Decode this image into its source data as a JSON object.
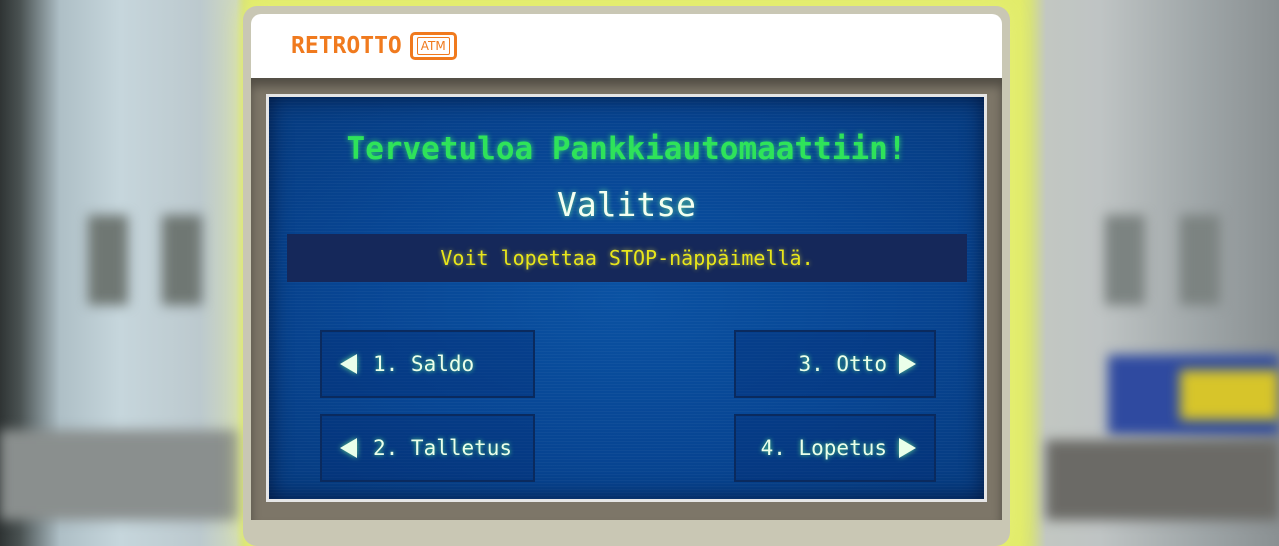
{
  "header": {
    "logo_text": "RETROTTO",
    "logo_badge": "ATM"
  },
  "screen": {
    "welcome": "Tervetuloa Pankkiautomaattiin!",
    "prompt": "Valitse",
    "notice": "Voit lopettaa STOP-näppäimellä."
  },
  "menu": {
    "saldo": "1. Saldo",
    "talletus": "2. Talletus",
    "otto": "3. Otto",
    "lopetus": "4. Lopetus"
  },
  "colors": {
    "brand_orange": "#f07a1e",
    "screen_blue": "#074593",
    "text_green": "#2ee35a",
    "notice_yellow": "#e8e61a"
  }
}
